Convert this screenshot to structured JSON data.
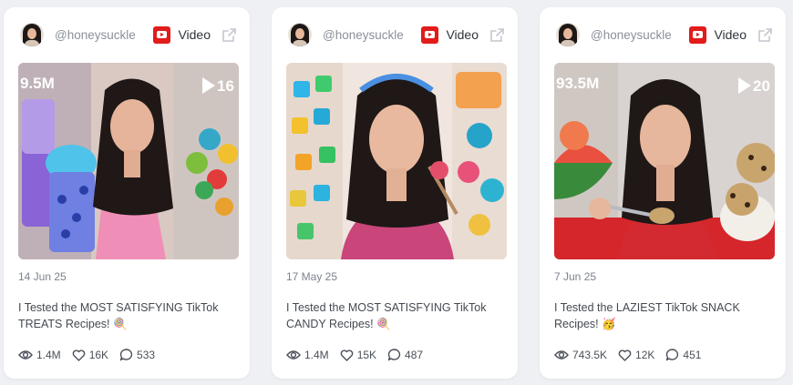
{
  "cards": [
    {
      "handle": "@honeysuckle",
      "platform": "Video",
      "thumb_text_left": "9.5M",
      "thumb_text_right": "16",
      "date": "14 Jun 25",
      "title": "I Tested the MOST SATISFYING TikTok TREATS Recipes! 🍭",
      "views": "1.4M",
      "likes": "16K",
      "comments": "533"
    },
    {
      "handle": "@honeysuckle",
      "platform": "Video",
      "date": "17 May 25",
      "title": "I Tested the MOST SATISFYING TikTok CANDY Recipes! 🍭",
      "views": "1.4M",
      "likes": "15K",
      "comments": "487"
    },
    {
      "handle": "@honeysuckle",
      "platform": "Video",
      "thumb_text_left": "93.5M",
      "thumb_text_right": "20",
      "date": "7 Jun 25",
      "title": "I Tested the LAZIEST TikTok SNACK Recipes! 🥳",
      "views": "743.5K",
      "likes": "12K",
      "comments": "451"
    }
  ],
  "colors": {
    "youtube": "#e21b1b",
    "card_bg": "#ffffff",
    "page_bg": "#eef0f4"
  },
  "icons": [
    "avatar",
    "youtube-icon",
    "external-link-icon",
    "eye-icon",
    "heart-icon",
    "comment-icon"
  ]
}
